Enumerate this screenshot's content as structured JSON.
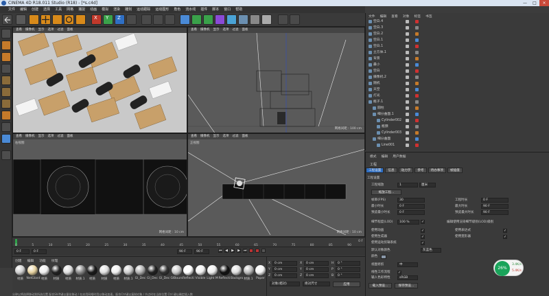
{
  "window": {
    "title": "CINEMA 4D R18.011 Studio (RC - R18) - [*未标题 1]",
    "title_shown": "CINEMA 4D R18.011 Studio (R18) - [*s.c4d]",
    "min": "—",
    "max": "□",
    "close": "×"
  },
  "menubar": [
    "文件",
    "编辑",
    "创建",
    "选择",
    "工具",
    "网格",
    "捕捉",
    "动画",
    "模拟",
    "渲染",
    "雕刻",
    "运动跟踪",
    "运动图形",
    "角色",
    "流水线",
    "插件",
    "脚本",
    "窗口",
    "帮助"
  ],
  "viewports": {
    "menu": [
      "查看",
      "摄像机",
      "显示",
      "选项",
      "过滤",
      "面板"
    ],
    "top_left": {
      "label": "透视视图"
    },
    "top_right": {
      "label": "",
      "grid": "网格间距 : 100 cm"
    },
    "bottom_left": {
      "label": "右视图",
      "grid": "网格间距 : 10 cm"
    },
    "bottom_right": {
      "label": "正视图",
      "grid": "网格间距 : 10 cm"
    }
  },
  "timeline": {
    "ticks": [
      "0",
      "5",
      "10",
      "15",
      "20",
      "25",
      "30",
      "35",
      "40",
      "45",
      "50",
      "55",
      "60",
      "65",
      "70",
      "75",
      "80",
      "85",
      "90"
    ],
    "end": "0 F"
  },
  "transport": {
    "start": "0 F",
    "current": "0 F",
    "end": "90 F",
    "end2": "90 F"
  },
  "material_panel": {
    "menu": [
      "创建",
      "编辑",
      "功能",
      "纹理"
    ],
    "materials": [
      "材质",
      "NetGlant",
      "材质",
      "材质",
      "材质",
      "材质.1",
      "材质",
      "材质",
      "材质",
      "材质.1",
      "Gl_Dec",
      "Gl_Dec",
      "Gl_Dec",
      "GlBours",
      "Reflecti",
      "Visible",
      "Light M",
      "Reflecti",
      "Backgro",
      "材质.1",
      "Paper"
    ]
  },
  "coord_panel": {
    "rows": [
      {
        "a": "X",
        "v1": "0 cm",
        "b": "X",
        "v2": "0 cm",
        "c": "H",
        "v3": "0 °"
      },
      {
        "a": "Y",
        "v1": "0 cm",
        "b": "Y",
        "v2": "0 cm",
        "c": "P",
        "v3": "0 °"
      },
      {
        "a": "Z",
        "v1": "0 cm",
        "b": "Z",
        "v2": "0 cm",
        "c": "B",
        "v3": "0 °"
      }
    ],
    "mode1": "对象(相对)",
    "mode2": "绝对尺寸",
    "apply": "应用"
  },
  "object_panel": {
    "tabs": [
      "文件",
      "编辑",
      "查看",
      "对象",
      "标签",
      "书签"
    ],
    "objects": [
      {
        "name": "空白.4",
        "indent": 0
      },
      {
        "name": "空白.3",
        "indent": 0
      },
      {
        "name": "空白.2",
        "indent": 0
      },
      {
        "name": "空白.1",
        "indent": 0
      },
      {
        "name": "空白.1",
        "indent": 0
      },
      {
        "name": "立方体.1",
        "indent": 0
      },
      {
        "name": "背景",
        "indent": 0
      },
      {
        "name": "最小",
        "indent": 0
      },
      {
        "name": "空白",
        "indent": 0
      },
      {
        "name": "摄像机.2",
        "indent": 0
      },
      {
        "name": "随机",
        "indent": 0
      },
      {
        "name": "天空",
        "indent": 0
      },
      {
        "name": "灯光",
        "indent": 0
      },
      {
        "name": "瓶子.1",
        "indent": 0
      },
      {
        "name": "圆柱",
        "indent": 1
      },
      {
        "name": "细分曲面.1",
        "indent": 1
      },
      {
        "name": "Cylinder002",
        "indent": 2
      },
      {
        "name": "瓶颈",
        "indent": 2
      },
      {
        "name": "Cylinder003",
        "indent": 2
      },
      {
        "name": "细分曲面",
        "indent": 1
      },
      {
        "name": "Line001",
        "indent": 2
      }
    ]
  },
  "attr_panel": {
    "tabs": [
      "模式",
      "编辑",
      "用户数据"
    ],
    "section": "工程",
    "subtabs": [
      "工程设置",
      "信息",
      "动力学",
      "参考",
      "待办事项",
      "帧插值"
    ],
    "header": "工程设置",
    "scale_label": "工程缩放",
    "scale_value": "1",
    "scale_unit": "厘米",
    "scale_btn": "缩放工程...",
    "left_fields": [
      {
        "label": "帧率(FPS)",
        "value": "30"
      },
      {
        "label": "最小时长",
        "value": "0 F"
      },
      {
        "label": "预览最小时长",
        "value": "0 F"
      }
    ],
    "right_fields": [
      {
        "label": "工程时长",
        "value": "0 F"
      },
      {
        "label": "最大时长",
        "value": "90 F"
      },
      {
        "label": "预览最大时长",
        "value": "90 F"
      }
    ],
    "lod_label": "细节程度(LOD)",
    "lod_value": "100 %",
    "lod_render": "编辑使用渲染细节级别(LOD)级别",
    "checks": [
      {
        "label": "使用动画",
        "r": "使用表达式"
      },
      {
        "label": "使用生成器",
        "r": "使用变形器"
      },
      {
        "label": "使用运动剪辑系统",
        "r": ""
      }
    ],
    "default_obj_color_label": "默认对象颜色",
    "default_obj_color": "灰蓝色",
    "color_label": "颜色",
    "view_clip_label": "视图修剪",
    "view_clip": "中",
    "linear_label": "线性工作流程",
    "input_color_label": "输入色彩特性",
    "input_color": "sRGB",
    "load_btn": "载入预设...",
    "save_btn": "保存预设..."
  },
  "widget": {
    "percent": "26%",
    "up": "3.4K/s",
    "down": "5.4K/s"
  },
  "status": "分钟以将选择移动到所选位置 配合Shift键以量化移动 / 在启用网格时用以移动加速。配合Ctrl键以复制对象 / 节点时在当前位置 Ctrl 键以确定插入数"
}
